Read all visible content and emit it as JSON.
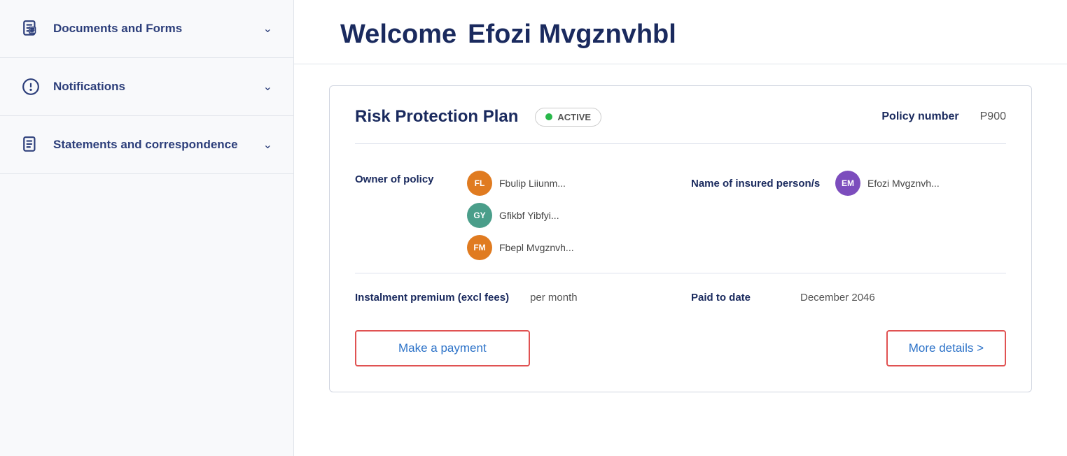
{
  "sidebar": {
    "items": [
      {
        "id": "documents-forms",
        "label": "Documents and Forms",
        "icon": "document-icon"
      },
      {
        "id": "notifications",
        "label": "Notifications",
        "icon": "notification-icon"
      },
      {
        "id": "statements",
        "label": "Statements and correspondence",
        "icon": "statements-icon"
      }
    ]
  },
  "header": {
    "welcome": "Welcome",
    "user_name": "Efozi Mvgznvhbl"
  },
  "policy": {
    "title": "Risk Protection Plan",
    "status": "ACTIVE",
    "policy_number_label": "Policy number",
    "policy_number_value": "P900",
    "owner_label": "Owner of policy",
    "owners": [
      {
        "initials": "FL",
        "name": "Fbulip Liiunm...",
        "color": "orange"
      },
      {
        "initials": "GY",
        "name": "Gfikbf Yibfyi...",
        "color": "teal"
      },
      {
        "initials": "FM",
        "name": "Fbepl Mvgznvh...",
        "color": "orange"
      }
    ],
    "insured_label": "Name of insured person/s",
    "insured": [
      {
        "initials": "EM",
        "name": "Efozi Mvgznvh...",
        "color": "purple"
      }
    ],
    "premium_label": "Instalment premium (excl fees)",
    "premium_value": "per month",
    "paid_to_date_label": "Paid to date",
    "paid_to_date_value": "December 2046",
    "make_payment_label": "Make a payment",
    "more_details_label": "More details >"
  }
}
